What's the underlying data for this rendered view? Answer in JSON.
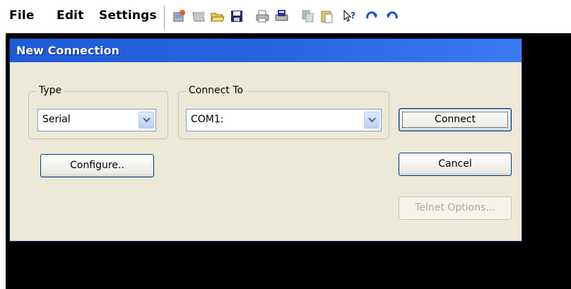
{
  "menubar": {
    "file_label": "File",
    "edit_label": "Edit",
    "settings_label": "Settings",
    "toolbar_icons": [
      "new-connection-icon",
      "disconnect-icon",
      "open-folder-icon",
      "save-icon",
      "print-icon",
      "print-preview-icon",
      "copy-icon",
      "paste-icon",
      "help-icon",
      "redo-icon",
      "undo-icon"
    ]
  },
  "dialog": {
    "title": "New Connection",
    "type_group_label": "Type",
    "type_value": "Serial",
    "connect_to_group_label": "Connect To",
    "connect_to_value": "COM1:",
    "configure_label": "Configure..",
    "connect_label": "Connect",
    "cancel_label": "Cancel",
    "telnet_options_label": "Telnet Options..."
  },
  "colors": {
    "titlebar": "#2a66e0",
    "dialog_bg": "#ece9d8",
    "desktop": "#000000"
  }
}
